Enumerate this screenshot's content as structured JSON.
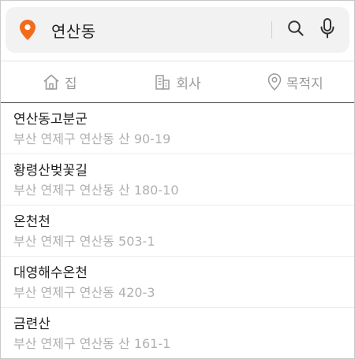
{
  "search": {
    "query": "연산동",
    "icons": {
      "location": "location-pin-icon",
      "search": "search-icon",
      "mic": "microphone-icon"
    },
    "accent_color": "#f26b1d"
  },
  "tabs": [
    {
      "label": "집",
      "icon": "home-icon"
    },
    {
      "label": "회사",
      "icon": "building-icon"
    },
    {
      "label": "목적지",
      "icon": "destination-pin-icon"
    }
  ],
  "results": [
    {
      "name": "연산동고분군",
      "address": "부산 연제구 연산동 산 90-19"
    },
    {
      "name": "황령산벚꽃길",
      "address": "부산 연제구 연산동 산 180-10"
    },
    {
      "name": "온천천",
      "address": "부산 연제구 연산동 503-1"
    },
    {
      "name": "대영해수온천",
      "address": "부산 연제구 연산동 420-3"
    },
    {
      "name": "금련산",
      "address": "부산 연제구 연산동 산 161-1"
    }
  ]
}
